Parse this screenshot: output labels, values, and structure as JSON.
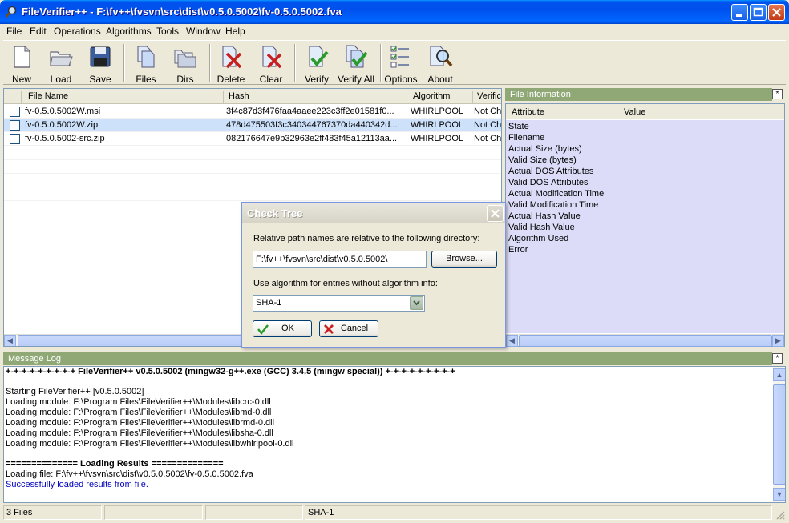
{
  "window": {
    "title": "FileVerifier++ - F:\\fv++\\fvsvn\\src\\dist\\v0.5.0.5002\\fv-0.5.0.5002.fva"
  },
  "menu": [
    "File",
    "Edit",
    "Operations",
    "Algorithms",
    "Tools",
    "Window",
    "Help"
  ],
  "toolbar": {
    "new": "New",
    "load": "Load",
    "save": "Save",
    "files": "Files",
    "dirs": "Dirs",
    "delete": "Delete",
    "clear": "Clear",
    "verify": "Verify",
    "verify_all": "Verify All",
    "options": "Options",
    "about": "About"
  },
  "filelist": {
    "columns": [
      "File Name",
      "Hash",
      "Algorithm",
      "Verific"
    ],
    "rows": [
      {
        "name": "fv-0.5.0.5002W.msi",
        "hash": "3f4c87d3f476faa4aaee223c3ff2e01581f0...",
        "algorithm": "WHIRLPOOL",
        "verification": "Not Ch"
      },
      {
        "name": "fv-0.5.0.5002W.zip",
        "hash": "478d475503f3c340344767370da440342d...",
        "algorithm": "WHIRLPOOL",
        "verification": "Not Ch"
      },
      {
        "name": "fv-0.5.0.5002-src.zip",
        "hash": "082176647e9b32963e2ff483f45a12113aa...",
        "algorithm": "WHIRLPOOL",
        "verification": "Not Ch"
      }
    ]
  },
  "fileinfo": {
    "caption": "File Information",
    "columns": [
      "Attribute",
      "Value"
    ],
    "attributes": [
      "State",
      "Filename",
      "Actual Size (bytes)",
      "Valid Size (bytes)",
      "Actual DOS Attributes",
      "Valid DOS Attributes",
      "Actual Modification Time",
      "Valid Modification Time",
      "Actual Hash Value",
      "Valid Hash Value",
      "Algorithm Used",
      "Error"
    ]
  },
  "messagelog": {
    "caption": "Message Log",
    "lines": [
      {
        "text": "+-+-+-+-+-+-+-+-+ FileVerifier++ v0.5.0.5002 (mingw32-g++.exe (GCC) 3.4.5 (mingw special)) +-+-+-+-+-+-+-+-+",
        "style": "bold"
      },
      {
        "text": "",
        "style": "normal"
      },
      {
        "text": "Starting FileVerifier++ [v0.5.0.5002]",
        "style": "normal"
      },
      {
        "text": "Loading module: F:\\Program Files\\FileVerifier++\\Modules\\libcrc-0.dll",
        "style": "normal"
      },
      {
        "text": "Loading module: F:\\Program Files\\FileVerifier++\\Modules\\libmd-0.dll",
        "style": "normal"
      },
      {
        "text": "Loading module: F:\\Program Files\\FileVerifier++\\Modules\\librmd-0.dll",
        "style": "normal"
      },
      {
        "text": "Loading module: F:\\Program Files\\FileVerifier++\\Modules\\libsha-0.dll",
        "style": "normal"
      },
      {
        "text": "Loading module: F:\\Program Files\\FileVerifier++\\Modules\\libwhirlpool-0.dll",
        "style": "normal"
      },
      {
        "text": "",
        "style": "normal"
      },
      {
        "text": "============== Loading Results ==============",
        "style": "bold"
      },
      {
        "text": "Loading file: F:\\fv++\\fvsvn\\src\\dist\\v0.5.0.5002\\fv-0.5.0.5002.fva",
        "style": "normal"
      },
      {
        "text": "Successfully loaded results from file.",
        "style": "blue"
      }
    ]
  },
  "statusbar": {
    "files": "3 Files",
    "algorithm": "SHA-1"
  },
  "dialog": {
    "title": "Check Tree",
    "path_label": "Relative path names are relative to the following directory:",
    "path_value": "F:\\fv++\\fvsvn\\src\\dist\\v0.5.0.5002\\",
    "browse": "Browse...",
    "algo_label": "Use algorithm for entries without algorithm info:",
    "algo_value": "SHA-1",
    "ok": "OK",
    "cancel": "Cancel"
  },
  "pin_symbol": "*",
  "colors": {
    "accent": "#0054e3",
    "panel_caption": "#8fa876",
    "fileinfo_bg": "#dcdcf8",
    "selected_row": "#cde1fb",
    "log_blue": "#0000c0"
  }
}
